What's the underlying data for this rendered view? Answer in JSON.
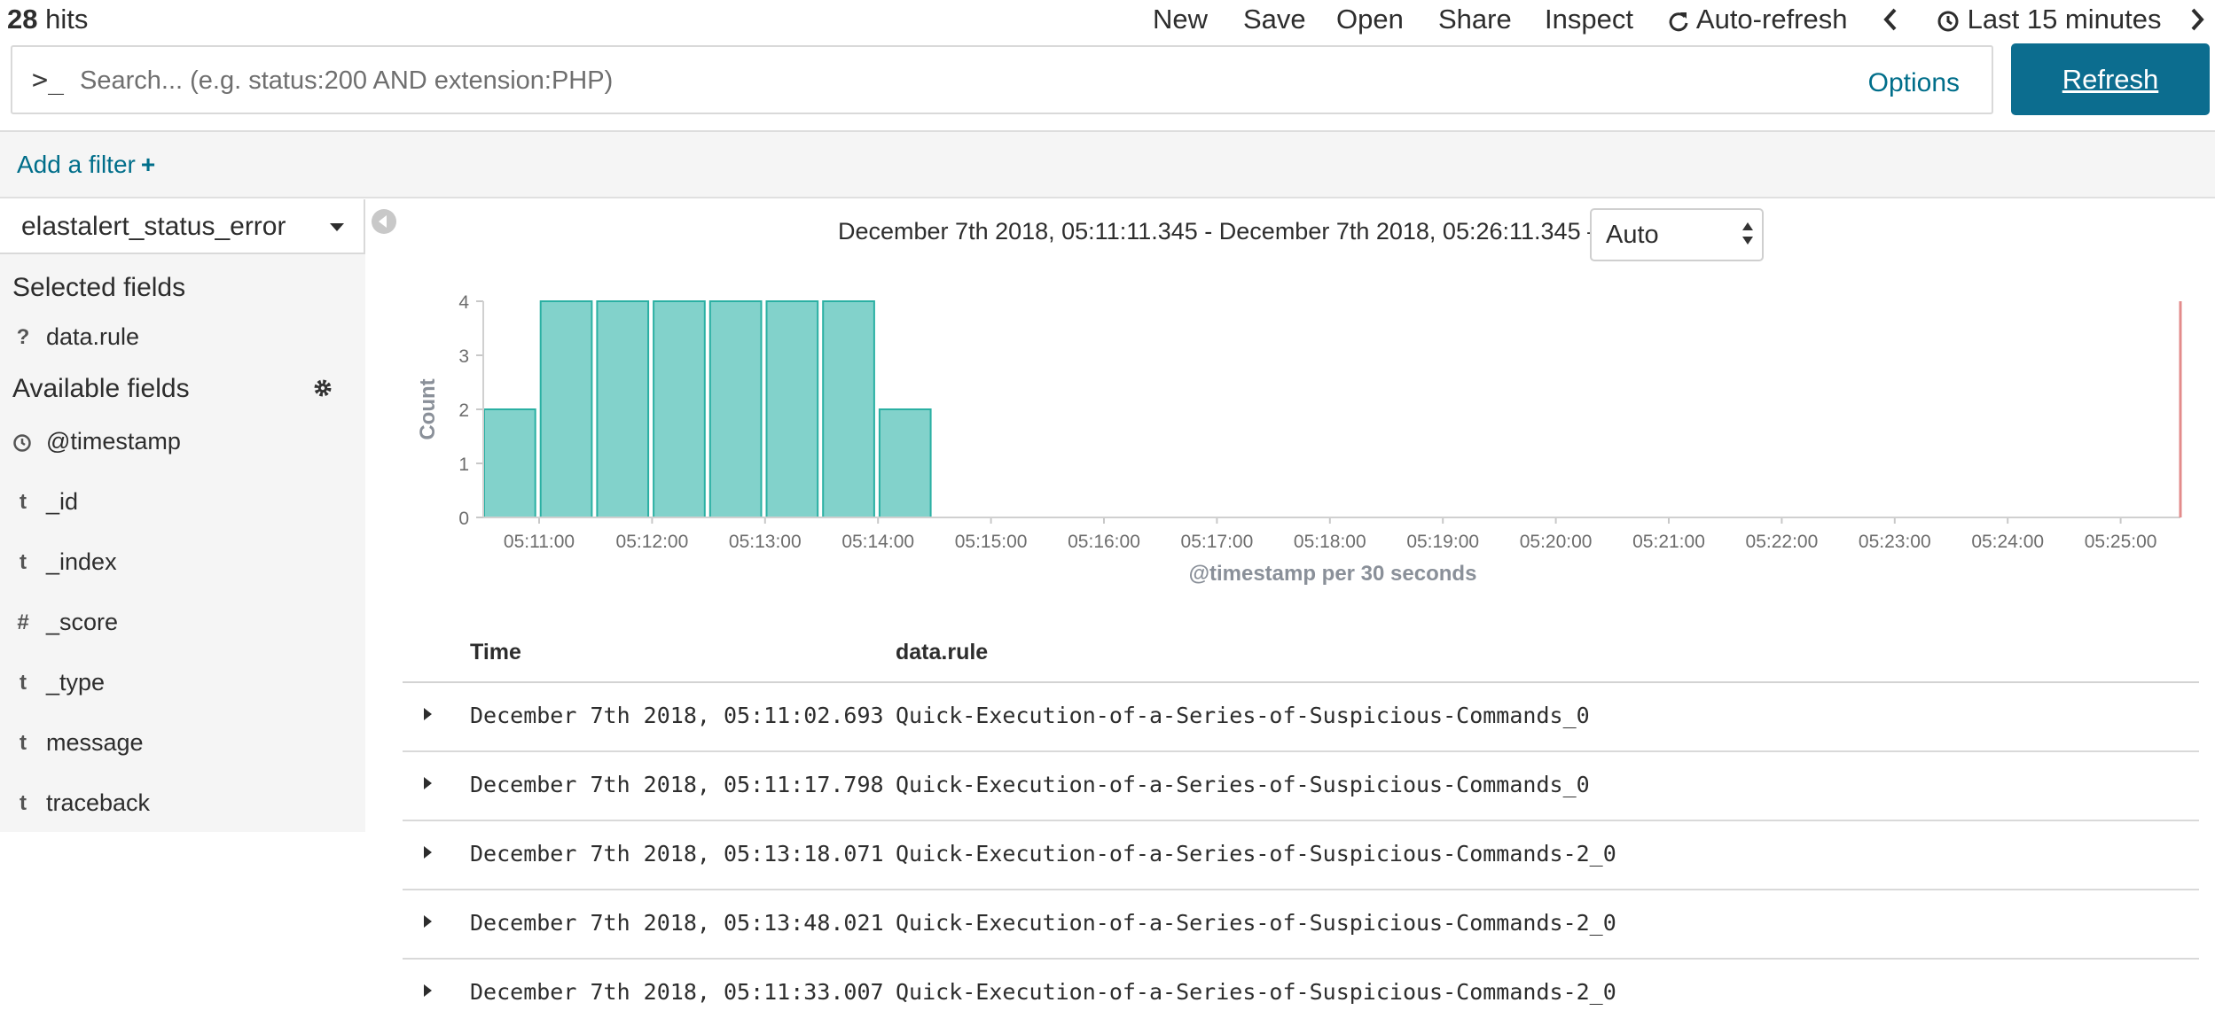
{
  "topnav": {
    "hits_count": "28",
    "hits_label": "hits",
    "items": {
      "new": "New",
      "save": "Save",
      "open": "Open",
      "share": "Share",
      "inspect": "Inspect",
      "auto_refresh": "Auto-refresh",
      "time_picker": "Last 15 minutes"
    }
  },
  "query": {
    "prompt": ">_",
    "placeholder": "Search... (e.g. status:200 AND extension:PHP)",
    "value": "",
    "options_label": "Options",
    "refresh_label": "Refresh"
  },
  "filters": {
    "add_label": "Add a filter",
    "add_plus": "+"
  },
  "sidebar": {
    "index_pattern": "elastalert_status_error",
    "selected_title": "Selected fields",
    "selected_fields": [
      {
        "type": "?",
        "name": "data.rule"
      }
    ],
    "available_title": "Available fields",
    "available_fields": [
      {
        "type": "clock",
        "name": "@timestamp"
      },
      {
        "type": "t",
        "name": "_id"
      },
      {
        "type": "t",
        "name": "_index"
      },
      {
        "type": "#",
        "name": "_score"
      },
      {
        "type": "t",
        "name": "_type"
      },
      {
        "type": "t",
        "name": "message"
      },
      {
        "type": "t",
        "name": "traceback"
      }
    ]
  },
  "histogram": {
    "range_text": "December 7th 2018, 05:11:11.345 - December 7th 2018, 05:26:11.345 —",
    "interval": "Auto"
  },
  "chart_data": {
    "type": "bar",
    "categories": [
      "05:10:30",
      "05:11:00",
      "05:11:30",
      "05:12:00",
      "05:12:30",
      "05:13:00",
      "05:13:30",
      "05:14:00"
    ],
    "values": [
      2,
      4,
      4,
      4,
      4,
      4,
      4,
      2
    ],
    "xlabel": "@timestamp per 30 seconds",
    "ylabel": "Count",
    "ylim": [
      0,
      4
    ],
    "yticks": [
      "0",
      "1",
      "2",
      "3",
      "4"
    ],
    "xticks": [
      "05:11:00",
      "05:12:00",
      "05:13:00",
      "05:14:00",
      "05:15:00",
      "05:16:00",
      "05:17:00",
      "05:18:00",
      "05:19:00",
      "05:20:00",
      "05:21:00",
      "05:22:00",
      "05:23:00",
      "05:24:00",
      "05:25:00"
    ],
    "bar_color": "#82d2cb",
    "bar_stroke": "#2bb0a3",
    "now_marker_color": "#e38b8b",
    "grid": false
  },
  "table": {
    "columns": [
      "Time",
      "data.rule"
    ],
    "rows": [
      {
        "time": "December 7th 2018, 05:11:02.693",
        "rule": "Quick-Execution-of-a-Series-of-Suspicious-Commands_0"
      },
      {
        "time": "December 7th 2018, 05:11:17.798",
        "rule": "Quick-Execution-of-a-Series-of-Suspicious-Commands_0"
      },
      {
        "time": "December 7th 2018, 05:13:18.071",
        "rule": "Quick-Execution-of-a-Series-of-Suspicious-Commands-2_0"
      },
      {
        "time": "December 7th 2018, 05:13:48.021",
        "rule": "Quick-Execution-of-a-Series-of-Suspicious-Commands-2_0"
      },
      {
        "time": "December 7th 2018, 05:11:33.007",
        "rule": "Quick-Execution-of-a-Series-of-Suspicious-Commands-2_0"
      }
    ]
  },
  "colors": {
    "accent": "#006e8a",
    "primary_button": "#0c6d8f",
    "panel_bg": "#f5f5f5"
  }
}
